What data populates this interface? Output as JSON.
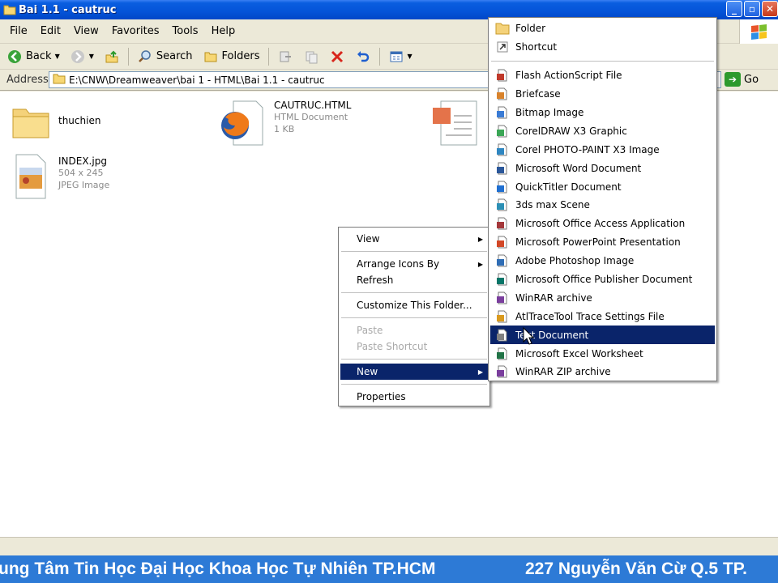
{
  "window": {
    "title": "Bai 1.1 - cautruc"
  },
  "menubar": {
    "items": [
      "File",
      "Edit",
      "View",
      "Favorites",
      "Tools",
      "Help"
    ]
  },
  "toolbar": {
    "back": "Back",
    "search": "Search",
    "folders": "Folders"
  },
  "address": {
    "label": "Address",
    "path": "E:\\CNW\\Dreamweaver\\bai 1 - HTML\\Bai 1.1 - cautruc",
    "go": "Go"
  },
  "files": [
    {
      "name": "thuchien",
      "type": "",
      "size": ""
    },
    {
      "name": "CAUTRUC.HTML",
      "type": "HTML Document",
      "size": "1 KB"
    },
    {
      "name": "INDEX.jpg",
      "type": "504 x 245",
      "size": "JPEG Image"
    }
  ],
  "context_menu": {
    "view": "View",
    "arrange": "Arrange Icons By",
    "refresh": "Refresh",
    "customize": "Customize This Folder...",
    "paste": "Paste",
    "paste_shortcut": "Paste Shortcut",
    "new": "New",
    "properties": "Properties"
  },
  "new_submenu": {
    "top": [
      "Folder",
      "Shortcut"
    ],
    "items": [
      {
        "label": "Flash ActionScript File",
        "icon": "flash-file-icon",
        "color": "#c0392b"
      },
      {
        "label": "Briefcase",
        "icon": "briefcase-icon",
        "color": "#d9822b"
      },
      {
        "label": "Bitmap Image",
        "icon": "bitmap-icon",
        "color": "#3a7bd5"
      },
      {
        "label": "CorelDRAW X3 Graphic",
        "icon": "coreldraw-icon",
        "color": "#3aa655"
      },
      {
        "label": "Corel PHOTO-PAINT X3 Image",
        "icon": "photopaint-icon",
        "color": "#2e86c1"
      },
      {
        "label": "Microsoft Word Document",
        "icon": "word-doc-icon",
        "color": "#2b579a"
      },
      {
        "label": "QuickTitler Document",
        "icon": "quicktitler-icon",
        "color": "#1f6fd1"
      },
      {
        "label": "3ds max Scene",
        "icon": "3dsmax-icon",
        "color": "#2b8fb5"
      },
      {
        "label": "Microsoft Office Access Application",
        "icon": "access-icon",
        "color": "#a4373a"
      },
      {
        "label": "Microsoft PowerPoint Presentation",
        "icon": "powerpoint-icon",
        "color": "#d24726"
      },
      {
        "label": "Adobe Photoshop Image",
        "icon": "photoshop-icon",
        "color": "#2f6db5"
      },
      {
        "label": "Microsoft Office Publisher Document",
        "icon": "publisher-icon",
        "color": "#077568"
      },
      {
        "label": "WinRAR archive",
        "icon": "winrar-icon",
        "color": "#7a3e9d"
      },
      {
        "label": "AtlTraceTool Trace Settings File",
        "icon": "trace-file-icon",
        "color": "#d99a1f"
      },
      {
        "label": "Text Document",
        "icon": "text-doc-icon",
        "color": "#808080"
      },
      {
        "label": "Microsoft Excel Worksheet",
        "icon": "excel-icon",
        "color": "#217346"
      },
      {
        "label": "WinRAR ZIP archive",
        "icon": "winrar-zip-icon",
        "color": "#7a3e9d"
      }
    ]
  },
  "banner": {
    "left": "ung Tâm Tin Học Đại Học Khoa Học Tự Nhiên TP.HCM",
    "right": "227 Nguyễn Văn Cừ  Q.5  TP."
  }
}
